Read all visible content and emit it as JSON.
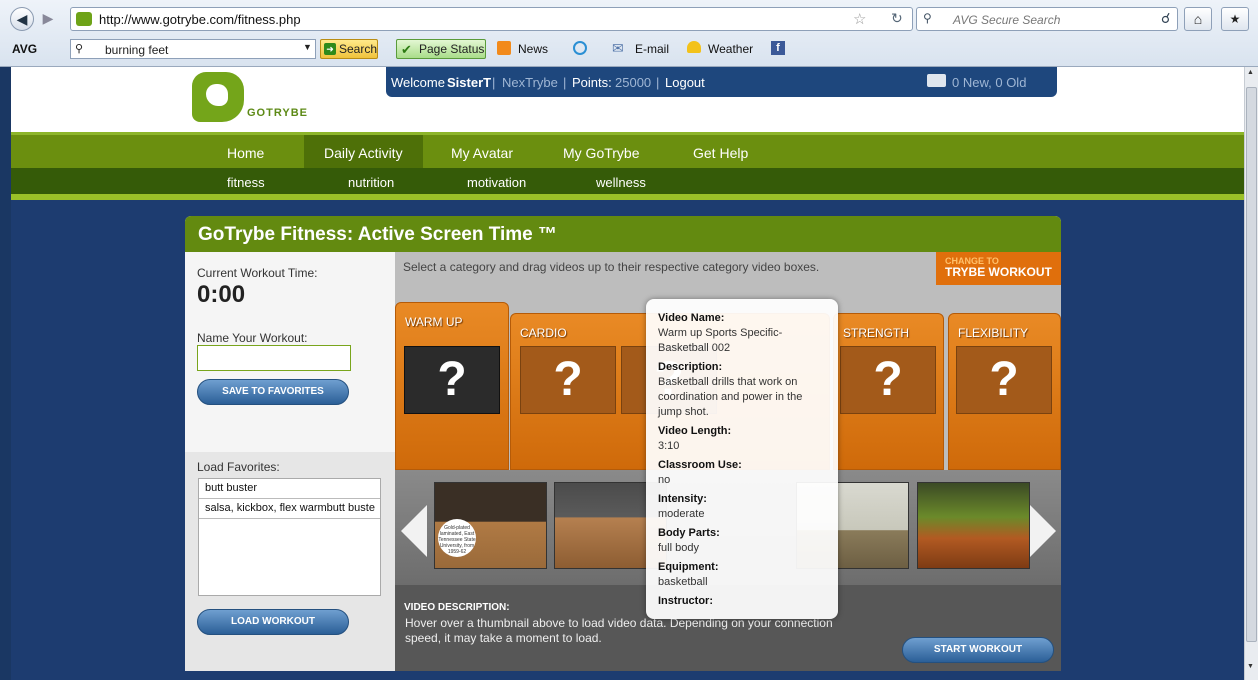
{
  "browser": {
    "url": "http://www.gotrybe.com/fitness.php",
    "search_placeholder": "AVG Secure Search",
    "avg_label": "AVG",
    "avg_search_value": "burning feet",
    "search_btn": "Search",
    "page_status_btn": "Page Status",
    "news": "News",
    "email": "E-mail",
    "weather": "Weather"
  },
  "site": {
    "logo_text": "GOTRYBE",
    "welcome": "Welcome",
    "username": "SisterT",
    "sep1": "|",
    "nextrybe": "NexTrybe",
    "sep2": "|",
    "points_label": "Points:",
    "points_value": "25000",
    "sep3": "|",
    "logout": "Logout",
    "messages": "0 New, 0 Old"
  },
  "nav": {
    "main": [
      "Home",
      "Daily Activity",
      "My Avatar",
      "My GoTrybe",
      "Get Help"
    ],
    "sub": [
      "fitness",
      "nutrition",
      "motivation",
      "wellness"
    ]
  },
  "panel": {
    "title": "GoTrybe Fitness: Active Screen Time ™",
    "current_time_label": "Current Workout Time:",
    "current_time": "0:00",
    "name_label": "Name Your Workout:",
    "save_btn": "SAVE TO FAVORITES",
    "load_label": "Load Favorites:",
    "favorites": [
      "butt buster",
      "salsa, kickbox, flex warmbutt buste"
    ],
    "load_btn": "LOAD WORKOUT",
    "instructions": "Select a category and drag videos up to their respective category video boxes.",
    "change_to": "CHANGE TO",
    "trybe_workout": "TRYBE WORKOUT",
    "categories": [
      "WARM UP",
      "CARDIO",
      "STRENGTH",
      "FLEXIBILITY"
    ],
    "qmark": "?",
    "video_desc_heading": "VIDEO DESCRIPTION:",
    "video_desc_text": "Hover over a thumbnail above to load video data. Depending on your connection speed, it may take a moment to load.",
    "start_btn": "START WORKOUT",
    "thumb_caption": "Gold-plated laminated, East Tennessee State University, from 1959-62"
  },
  "tooltip": {
    "name_label": "Video Name:",
    "name_value": "Warm up Sports Specific-Basketball 002",
    "desc_label": "Description:",
    "desc_value": "Basketball drills that work on coordination and power in the jump shot.",
    "length_label": "Video Length:",
    "length_value": "3:10",
    "class_label": "Classroom Use:",
    "class_value": "no",
    "intensity_label": "Intensity:",
    "intensity_value": "moderate",
    "body_label": "Body Parts:",
    "body_value": "full body",
    "equip_label": "Equipment:",
    "equip_value": "basketball",
    "instructor_label": "Instructor:"
  }
}
